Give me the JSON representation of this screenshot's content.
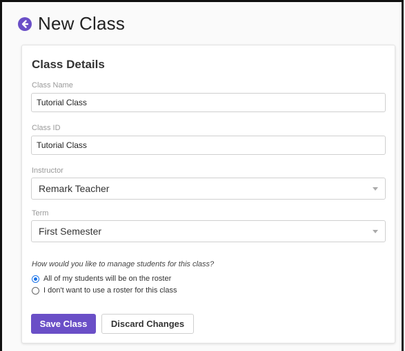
{
  "header": {
    "title": "New Class",
    "back_icon": "circle-arrow-left-icon",
    "accent_color": "#6a4fc7"
  },
  "card": {
    "title": "Class Details",
    "fields": {
      "class_name": {
        "label": "Class Name",
        "value": "Tutorial Class"
      },
      "class_id": {
        "label": "Class ID",
        "value": "Tutorial Class"
      },
      "instructor": {
        "label": "Instructor",
        "value": "Remark Teacher"
      },
      "term": {
        "label": "Term",
        "value": "First Semester"
      }
    },
    "roster": {
      "question": "How would you like to manage students for this class?",
      "options": [
        {
          "label": "All of my students will be on the roster",
          "checked": true
        },
        {
          "label": "I don't want to use a roster for this class",
          "checked": false
        }
      ]
    },
    "buttons": {
      "save": "Save Class",
      "discard": "Discard Changes"
    }
  }
}
